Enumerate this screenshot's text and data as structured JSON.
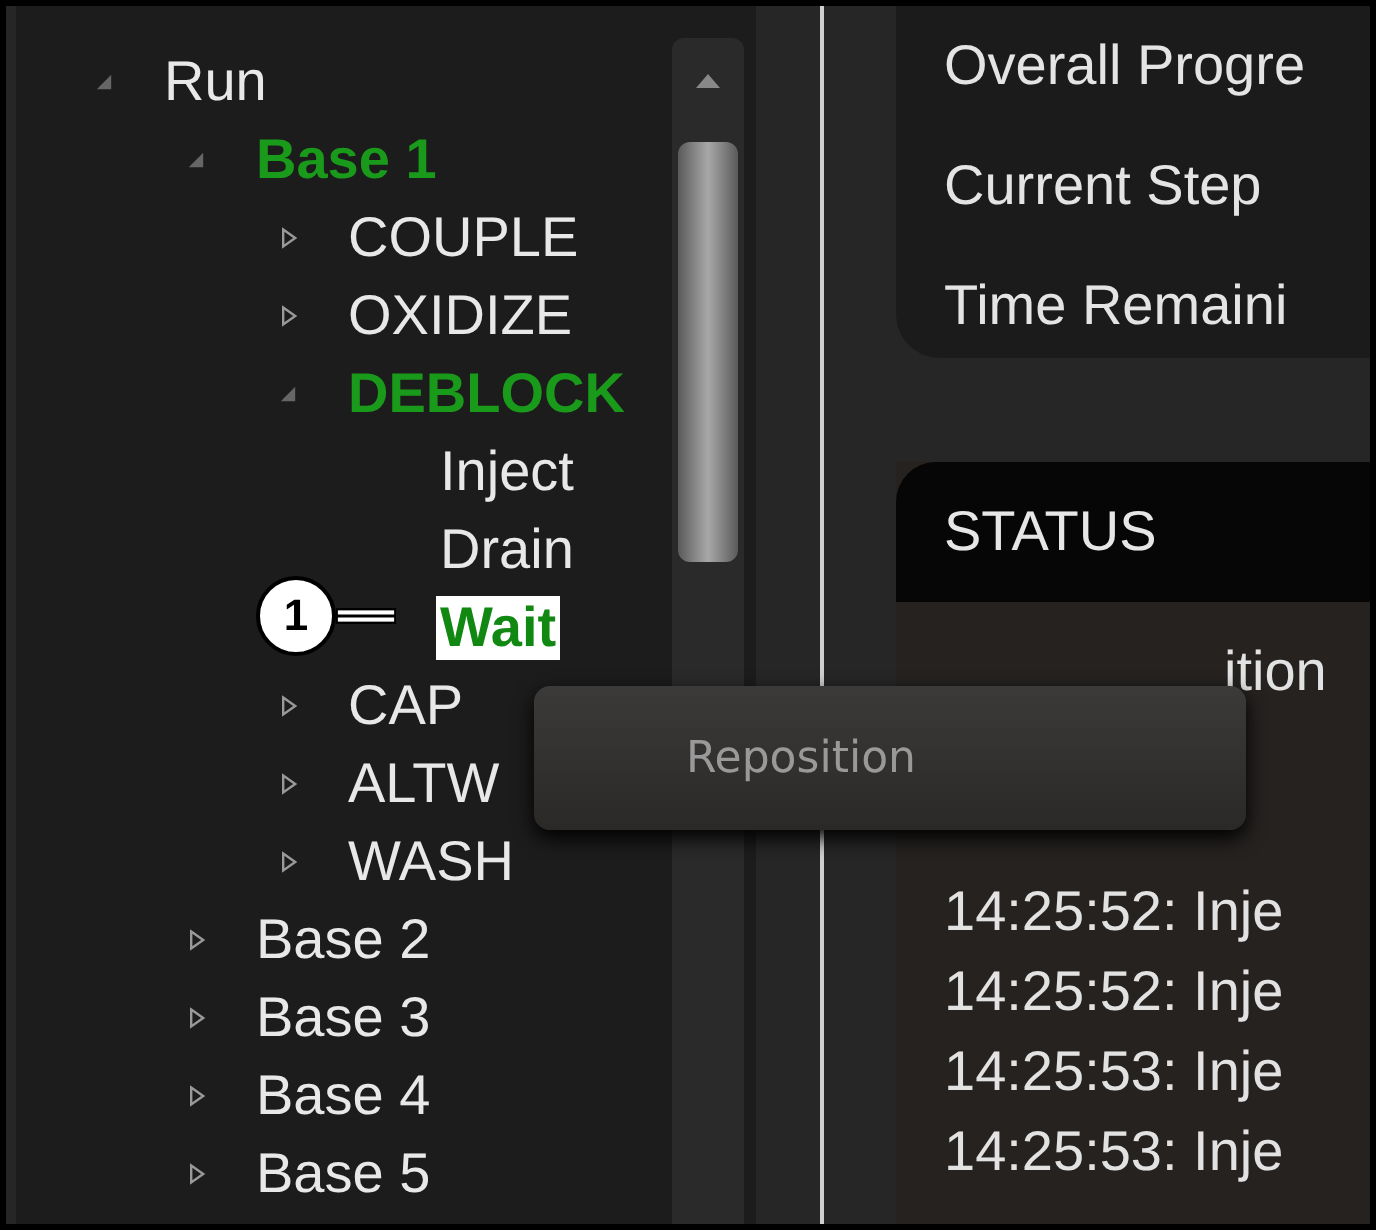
{
  "tree": [
    {
      "label": "Run",
      "expanded": true,
      "active": false,
      "selected": false,
      "children": [
        {
          "label": "Base 1",
          "expanded": true,
          "active": true,
          "selected": false,
          "children": [
            {
              "label": "COUPLE",
              "expanded": false,
              "active": false,
              "selected": false
            },
            {
              "label": "OXIDIZE",
              "expanded": false,
              "active": false,
              "selected": false
            },
            {
              "label": "DEBLOCK",
              "expanded": true,
              "active": true,
              "selected": false,
              "children": [
                {
                  "label": "Inject",
                  "active": false,
                  "selected": false
                },
                {
                  "label": "Drain",
                  "active": false,
                  "selected": false
                },
                {
                  "label": "Wait",
                  "active": true,
                  "selected": true
                }
              ]
            },
            {
              "label": "CAP",
              "expanded": false,
              "active": false,
              "selected": false
            },
            {
              "label": "ALTW",
              "expanded": false,
              "active": false,
              "selected": false
            },
            {
              "label": "WASH",
              "expanded": false,
              "active": false,
              "selected": false
            }
          ]
        },
        {
          "label": "Base 2",
          "expanded": false,
          "active": false,
          "selected": false
        },
        {
          "label": "Base 3",
          "expanded": false,
          "active": false,
          "selected": false
        },
        {
          "label": "Base 4",
          "expanded": false,
          "active": false,
          "selected": false
        },
        {
          "label": "Base 5",
          "expanded": false,
          "active": false,
          "selected": false
        }
      ]
    }
  ],
  "callout": {
    "number": "1"
  },
  "progress": [
    "Overall Progre",
    "Current Step",
    "Time Remaini"
  ],
  "status": {
    "title": "STATUS",
    "log": [
      "ition",
      "14:25:52: Inje",
      "14:25:52: Inje",
      "14:25:53: Inje",
      "14:25:53: Inje"
    ]
  },
  "context_menu": {
    "items": [
      "Reposition"
    ]
  }
}
